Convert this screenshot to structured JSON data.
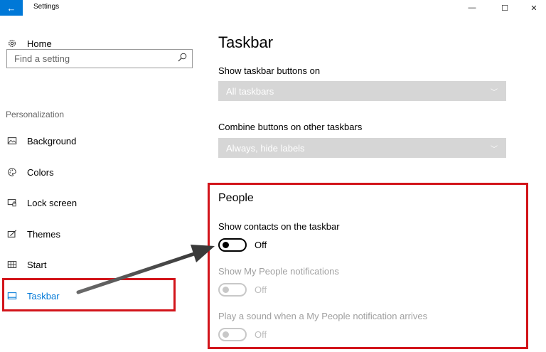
{
  "window": {
    "title": "Settings",
    "back_icon": "back-arrow-icon",
    "min_glyph": "—",
    "max_glyph": "☐",
    "close_glyph": "✕"
  },
  "sidebar": {
    "home_label": "Home",
    "search_placeholder": "Find a setting",
    "section_label": "Personalization",
    "items": [
      {
        "label": "Background",
        "icon": "picture-icon"
      },
      {
        "label": "Colors",
        "icon": "palette-icon"
      },
      {
        "label": "Lock screen",
        "icon": "lock-screen-icon"
      },
      {
        "label": "Themes",
        "icon": "themes-icon"
      },
      {
        "label": "Start",
        "icon": "start-icon"
      },
      {
        "label": "Taskbar",
        "icon": "taskbar-icon",
        "active": true
      }
    ]
  },
  "main": {
    "title": "Taskbar",
    "show_buttons_label": "Show taskbar buttons on",
    "show_buttons_value": "All taskbars",
    "combine_label": "Combine buttons on other taskbars",
    "combine_value": "Always, hide labels",
    "people_heading": "People",
    "toggles": [
      {
        "label": "Show contacts on the taskbar",
        "state": "Off",
        "enabled": true
      },
      {
        "label": "Show My People notifications",
        "state": "Off",
        "enabled": false
      },
      {
        "label": "Play a sound when a My People notification arrives",
        "state": "Off",
        "enabled": false
      }
    ]
  },
  "colors": {
    "accent": "#0078d7",
    "highlight": "#d2141a",
    "dropdown_bg": "#d6d6d6"
  }
}
